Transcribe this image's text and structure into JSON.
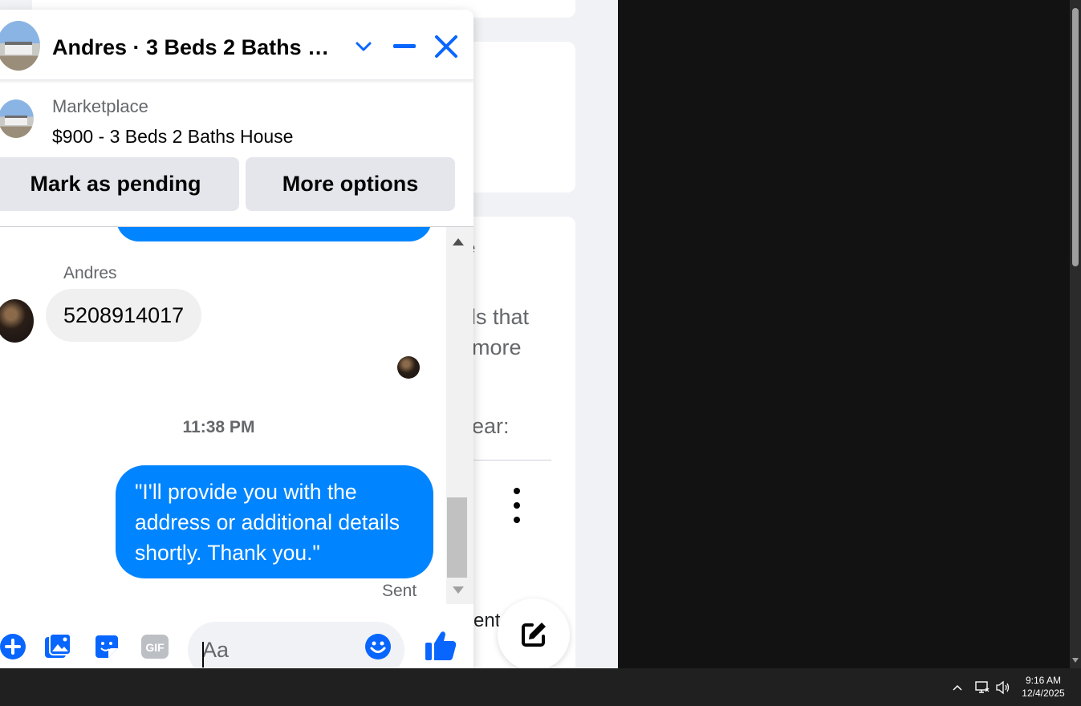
{
  "background": {
    "fragments": [
      "e",
      "ds that",
      "more",
      "ear:",
      "ent"
    ]
  },
  "chat": {
    "title": "Andres · 3 Beds 2 Baths House",
    "listing": {
      "source": "Marketplace",
      "title": "$900 - 3 Beds 2 Baths House",
      "pending_label": "Mark as pending",
      "more_label": "More options"
    },
    "messages": {
      "sender_name": "Andres",
      "incoming_text": "5208914017",
      "timestamp": "11:38 PM",
      "outgoing_text": "\"I'll provide you with the address or additional details shortly. Thank you.\"",
      "status": "Sent"
    },
    "composer": {
      "placeholder": "Aa",
      "gif_label": "GIF"
    },
    "colors": {
      "accent": "#0084ff",
      "icon_blue": "#0866ff"
    },
    "icons": [
      "minimize-icon",
      "close-icon",
      "chevron-down-icon",
      "plus-icon",
      "photo-icon",
      "sticker-icon",
      "gif-icon",
      "emoji-icon",
      "thumbs-up-icon",
      "compose-icon"
    ]
  },
  "taskbar": {
    "time": "9:16 AM",
    "date": "12/4/2025"
  }
}
